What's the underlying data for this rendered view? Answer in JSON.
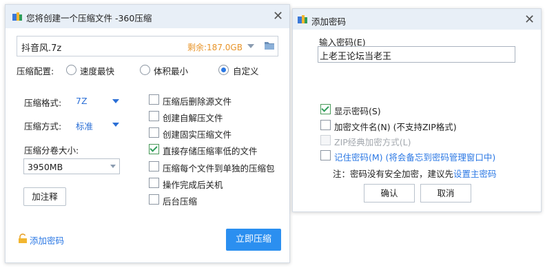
{
  "compress_window": {
    "title": "您将创建一个压缩文件 -360压缩",
    "file_name": "抖音风.7z",
    "free_space": "剩余:187.0GB",
    "config_label": "压缩配置:",
    "config_options": [
      {
        "label": "速度最快",
        "selected": false
      },
      {
        "label": "体积最小",
        "selected": false
      },
      {
        "label": "自定义",
        "selected": true
      }
    ],
    "format_label": "压缩格式:",
    "format_value": "7Z",
    "method_label": "压缩方式:",
    "method_value": "标准",
    "split_label": "压缩分卷大小:",
    "split_value": "3950MB",
    "comment_button": "加注释",
    "options": [
      {
        "label": "压缩后删除源文件",
        "checked": false
      },
      {
        "label": "创建自解压文件",
        "checked": false
      },
      {
        "label": "创建固实压缩文件",
        "checked": false
      },
      {
        "label": "直接存储压缩率低的文件",
        "checked": true
      },
      {
        "label": "压缩每个文件到单独的压缩包",
        "checked": false
      },
      {
        "label": "操作完成后关机",
        "checked": false
      },
      {
        "label": "后台压缩",
        "checked": false
      }
    ],
    "add_password_link": "添加密码",
    "compress_button": "立即压缩",
    "accent_color": "#2b8ff0",
    "free_space_color": "#e8952a"
  },
  "password_window": {
    "title": "添加密码",
    "input_label": "输入密码(E)",
    "password_value": "上老王论坛当老王",
    "options": [
      {
        "label": "显示密码(S)",
        "checked": true,
        "disabled": false
      },
      {
        "label": "加密文件名(N) (不支持ZIP格式)",
        "checked": false,
        "disabled": false
      },
      {
        "label": "ZIP经典加密方式(L)",
        "checked": false,
        "disabled": true
      },
      {
        "label": "记住密码(M) (将会备忘到密码管理窗口中)",
        "checked": false,
        "disabled": false
      }
    ],
    "note_prefix": "注：密码没有安全加密，建议先",
    "note_link": "设置主密码",
    "ok_button": "确认",
    "cancel_button": "取消"
  }
}
